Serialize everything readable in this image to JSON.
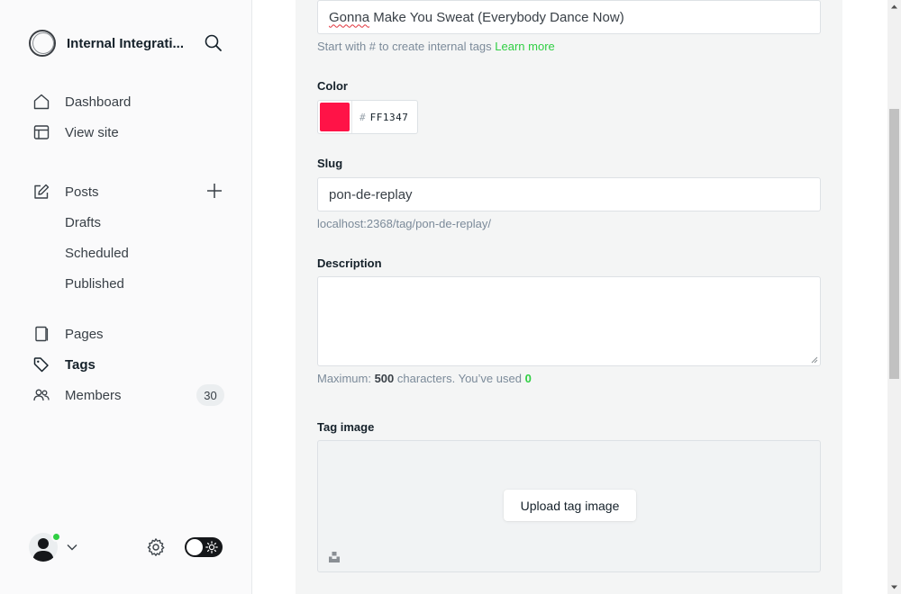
{
  "sidebar": {
    "brand_name": "Internal Integrati...",
    "items": {
      "dashboard": "Dashboard",
      "view_site": "View site",
      "posts": "Posts",
      "drafts": "Drafts",
      "scheduled": "Scheduled",
      "published": "Published",
      "pages": "Pages",
      "tags": "Tags",
      "members": "Members",
      "members_count": "30"
    },
    "icons": [
      "house-icon",
      "layout-icon",
      "pencil-square-icon",
      "plus-icon",
      "book-icon",
      "tag-icon",
      "users-icon",
      "search-icon",
      "gear-icon",
      "sun-icon",
      "chevron-down-icon"
    ],
    "status_color": "#30cf43"
  },
  "form": {
    "name_value": "Gonna Make You Sweat (Everybody Dance Now)",
    "name_value_first_word": "Gonna",
    "name_value_rest": " Make You Sweat (Everybody Dance Now)",
    "name_hint": "Start with # to create internal tags",
    "name_hint_link": "Learn more",
    "color_label": "Color",
    "color_hash": "#",
    "color_value": "FF1347",
    "color_swatch": "#FF1347",
    "slug_label": "Slug",
    "slug_value": "pon-de-replay",
    "slug_url": "localhost:2368/tag/pon-de-replay/",
    "description_label": "Description",
    "description_value": "",
    "desc_hint_prefix": "Maximum:",
    "desc_hint_max": "500",
    "desc_hint_mid": "characters. You’ve used",
    "desc_hint_used": "0",
    "tag_image_label": "Tag image",
    "upload_button": "Upload tag image"
  },
  "accent_color": "#30cf43"
}
